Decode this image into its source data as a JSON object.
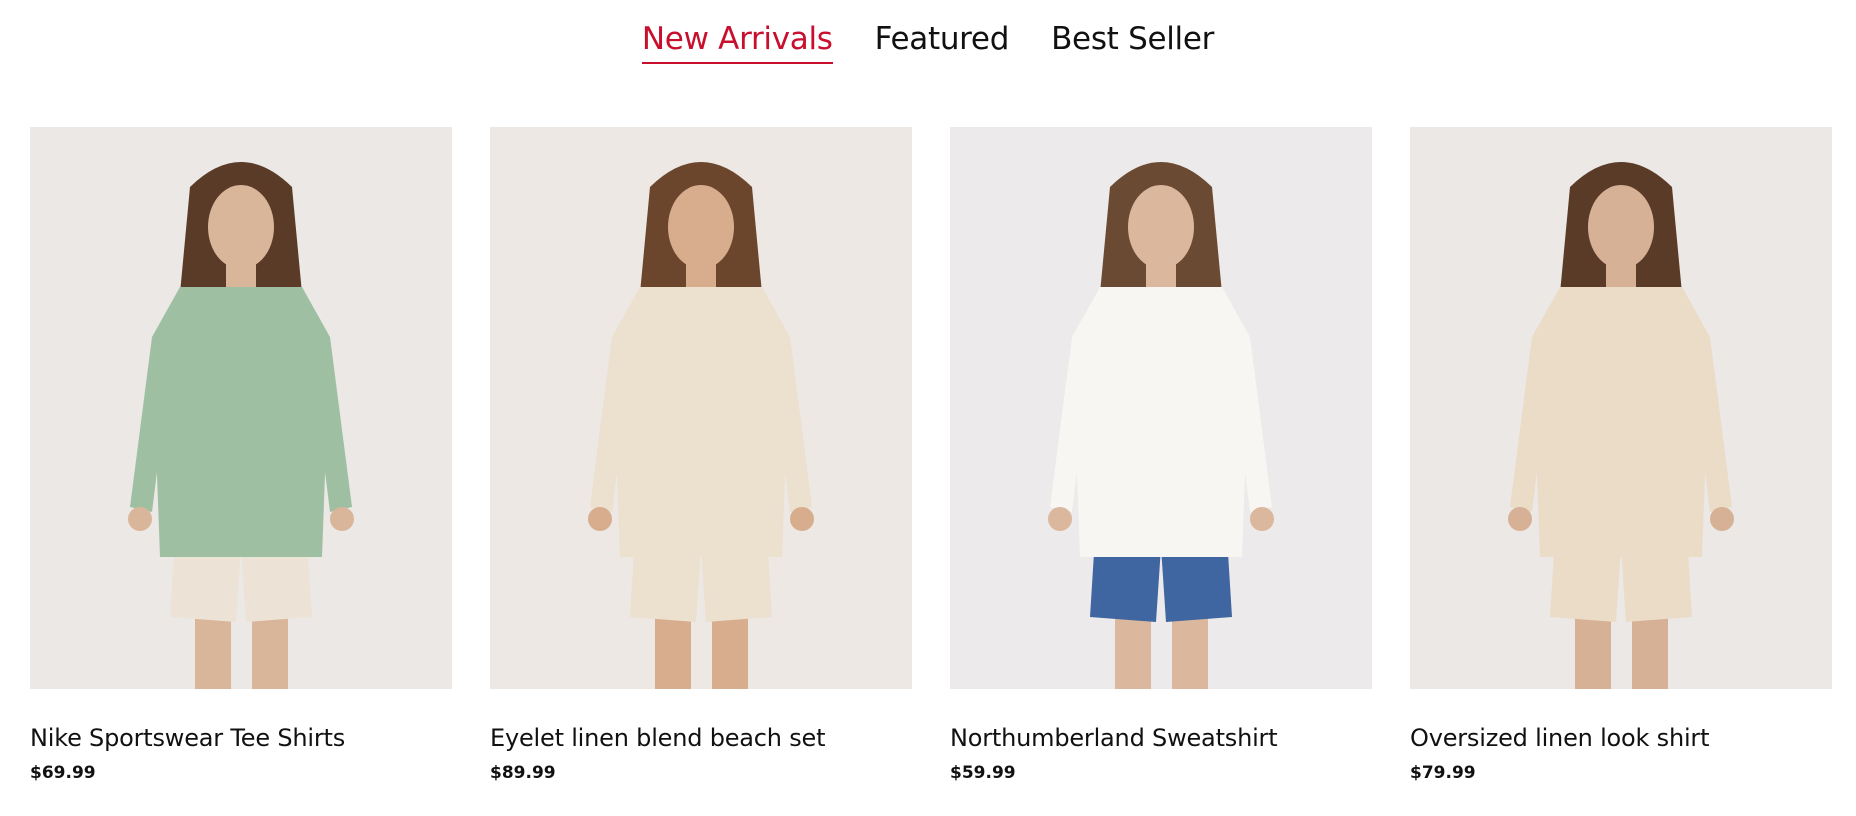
{
  "tabs": [
    {
      "label": "New Arrivals",
      "active": true
    },
    {
      "label": "Featured",
      "active": false
    },
    {
      "label": "Best Seller",
      "active": false
    }
  ],
  "products": [
    {
      "name": "Nike Sportswear Tee Shirts",
      "price": "$69.99",
      "colors": {
        "bg": "#ece8e5",
        "top": "#9fbfa3",
        "bottom": "#ede2d6",
        "skin": "#d9b59a",
        "hair": "#5a3b28"
      }
    },
    {
      "name": "Eyelet linen blend beach set",
      "price": "$89.99",
      "colors": {
        "bg": "#ede8e3",
        "top": "#ece0cf",
        "bottom": "#ece0cf",
        "skin": "#d7ad8e",
        "hair": "#6b452c"
      }
    },
    {
      "name": "Northumberland Sweatshirt",
      "price": "$59.99",
      "colors": {
        "bg": "#eceaea",
        "top": "#f7f6f2",
        "bottom": "#3f66a0",
        "skin": "#dab79d",
        "hair": "#6b4a33"
      }
    },
    {
      "name": "Oversized linen look shirt",
      "price": "$79.99",
      "colors": {
        "bg": "#ece8e5",
        "top": "#eadcc7",
        "bottom": "#eadcc7",
        "skin": "#d6b195",
        "hair": "#5a3b28"
      }
    }
  ]
}
